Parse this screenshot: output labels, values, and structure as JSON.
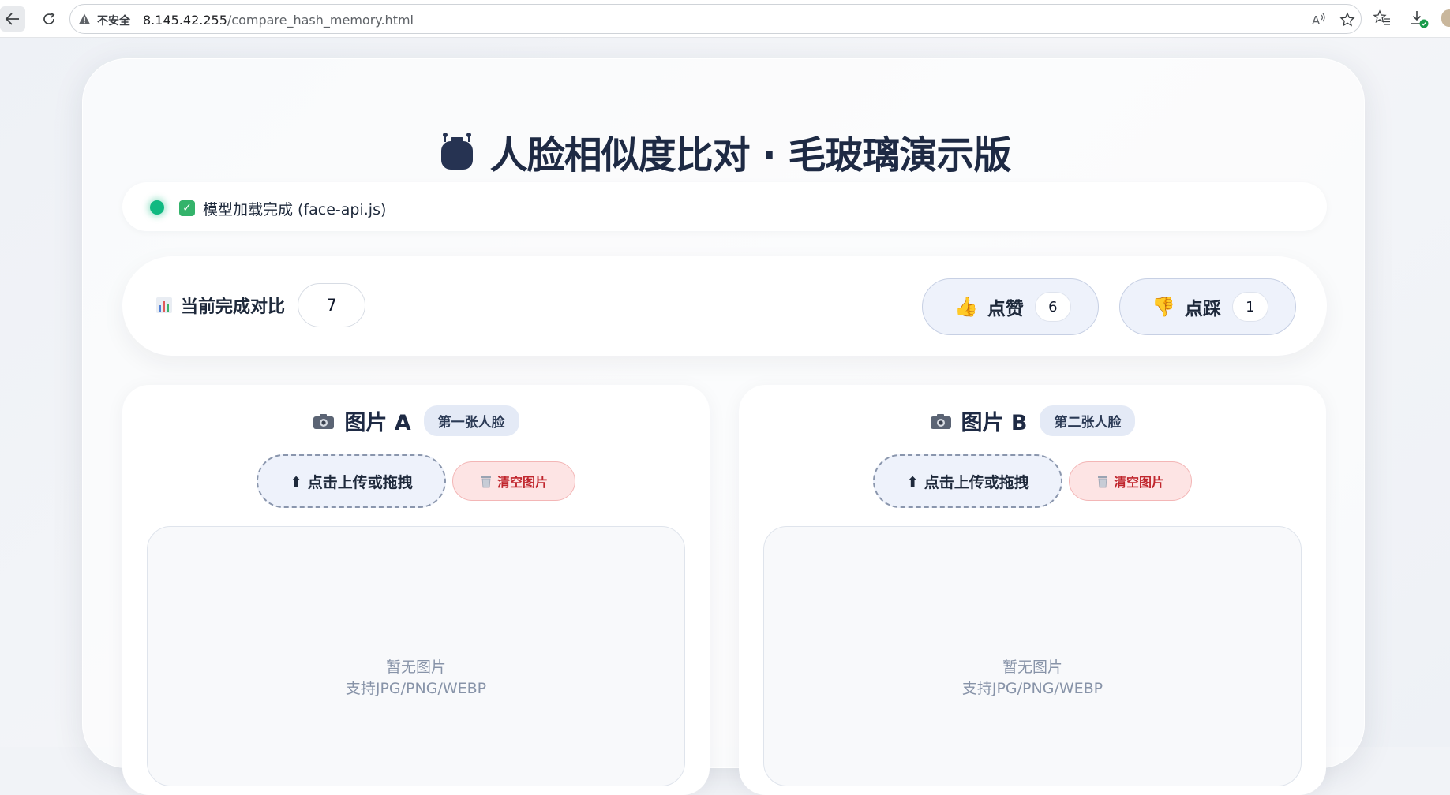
{
  "browser": {
    "security_label": "不安全",
    "url_host": "8.145.42.255",
    "url_path": "/compare_hash_memory.html"
  },
  "page": {
    "title": "人脸相似度比对 · 毛玻璃演示版",
    "status": {
      "text": "模型加载完成 (face-api.js)",
      "state": "loaded",
      "dot_color": "#10b981"
    },
    "stats": {
      "label": "当前完成对比",
      "count": "7",
      "like": {
        "emoji": "👍",
        "label": "点赞",
        "count": "6"
      },
      "dislike": {
        "emoji": "👎",
        "label": "点踩",
        "count": "1"
      }
    },
    "panels": [
      {
        "title": "图片 A",
        "tag": "第一张人脸",
        "upload_label": "⬆ 点击上传或拖拽",
        "clear_label": "清空图片",
        "empty_line1": "暂无图片",
        "empty_line2": "支持JPG/PNG/WEBP"
      },
      {
        "title": "图片 B",
        "tag": "第二张人脸",
        "upload_label": "⬆ 点击上传或拖拽",
        "clear_label": "清空图片",
        "empty_line1": "暂无图片",
        "empty_line2": "支持JPG/PNG/WEBP"
      }
    ]
  },
  "icons": [
    "back-icon",
    "reload-icon",
    "warning-icon",
    "read-aloud-icon",
    "favorite-star-icon",
    "favorites-icon",
    "download-icon",
    "profile-icon",
    "robot-icon",
    "check-icon",
    "chart-icon",
    "camera-icon",
    "trash-icon"
  ]
}
